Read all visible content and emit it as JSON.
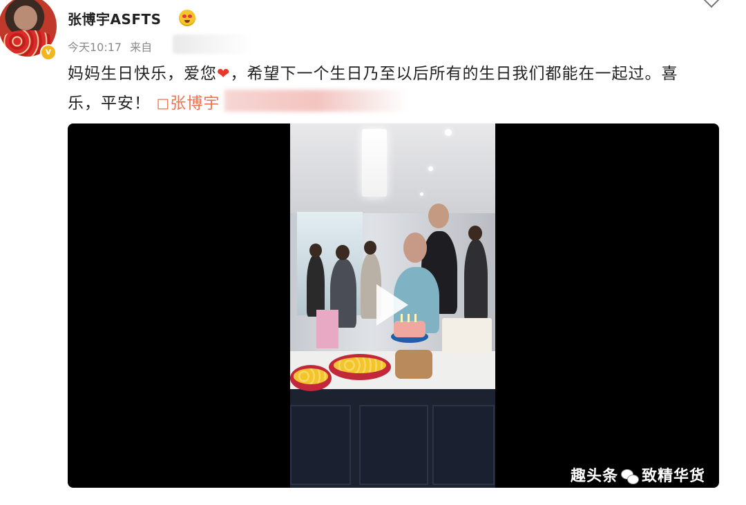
{
  "post": {
    "username": "张博宇ASFTS",
    "time": "今天10:17",
    "source_prefix": "来自",
    "text_part1": "妈妈生日快乐，爱您",
    "text_part2": "，希望下一个生日乃至以后所有的生日我们都能在一起过。喜乐，平安！",
    "topic_link": "◻张博宇"
  },
  "icons": {
    "verified": "verified-badge-icon",
    "emoji": "heart-eyes-emoji-icon",
    "heart": "red-heart-icon",
    "play": "play-icon",
    "menu": "chevron-down-icon"
  },
  "video": {
    "description_visible": false
  },
  "watermark": {
    "left": "趣头条",
    "right": "致精华货"
  },
  "colors": {
    "link": "#eb7350",
    "heart": "#e8372c",
    "verified": "#f3b51d"
  }
}
